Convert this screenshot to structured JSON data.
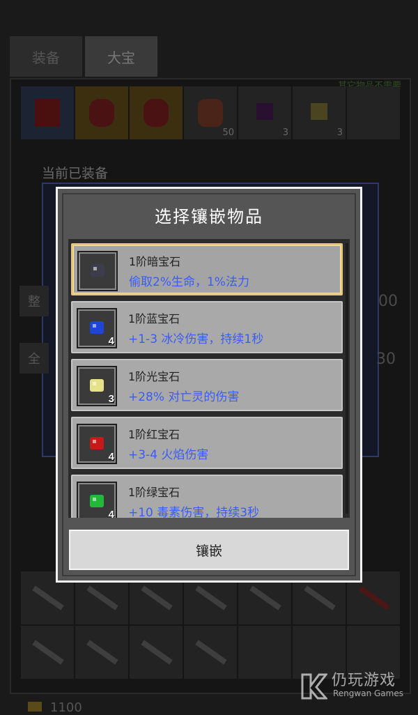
{
  "background": {
    "tabs": [
      {
        "label": "装备"
      },
      {
        "label": "大宝"
      }
    ],
    "hint": "其它物品不需要",
    "equipped_label": "当前已装备",
    "inventory_counts": [
      "50",
      "3",
      "3"
    ],
    "left_button_1": "整",
    "left_button_2": "全",
    "right_number_1": "00",
    "right_number_2": "30",
    "gold": "1100"
  },
  "modal": {
    "title": "选择镶嵌物品",
    "items": [
      {
        "name": "1阶暗宝石",
        "desc": "偷取2%生命，1%法力",
        "qty": "",
        "gem_color": "#3c3c4a",
        "selected": true
      },
      {
        "name": "1阶蓝宝石",
        "desc": "+1-3 冰冷伤害，持续1秒",
        "qty": "4",
        "gem_color": "#1f45d8"
      },
      {
        "name": "1阶光宝石",
        "desc": "+28% 对亡灵的伤害",
        "qty": "3",
        "gem_color": "#e6e28a"
      },
      {
        "name": "1阶红宝石",
        "desc": "+3-4 火焰伤害",
        "qty": "4",
        "gem_color": "#c41a1a"
      },
      {
        "name": "1阶绿宝石",
        "desc": "+10 毒素伤害，持续3秒",
        "qty": "4",
        "gem_color": "#22b83a"
      }
    ],
    "confirm_label": "镶嵌"
  },
  "watermark": {
    "cn": "仍玩游戏",
    "en": "Rengwan Games"
  }
}
